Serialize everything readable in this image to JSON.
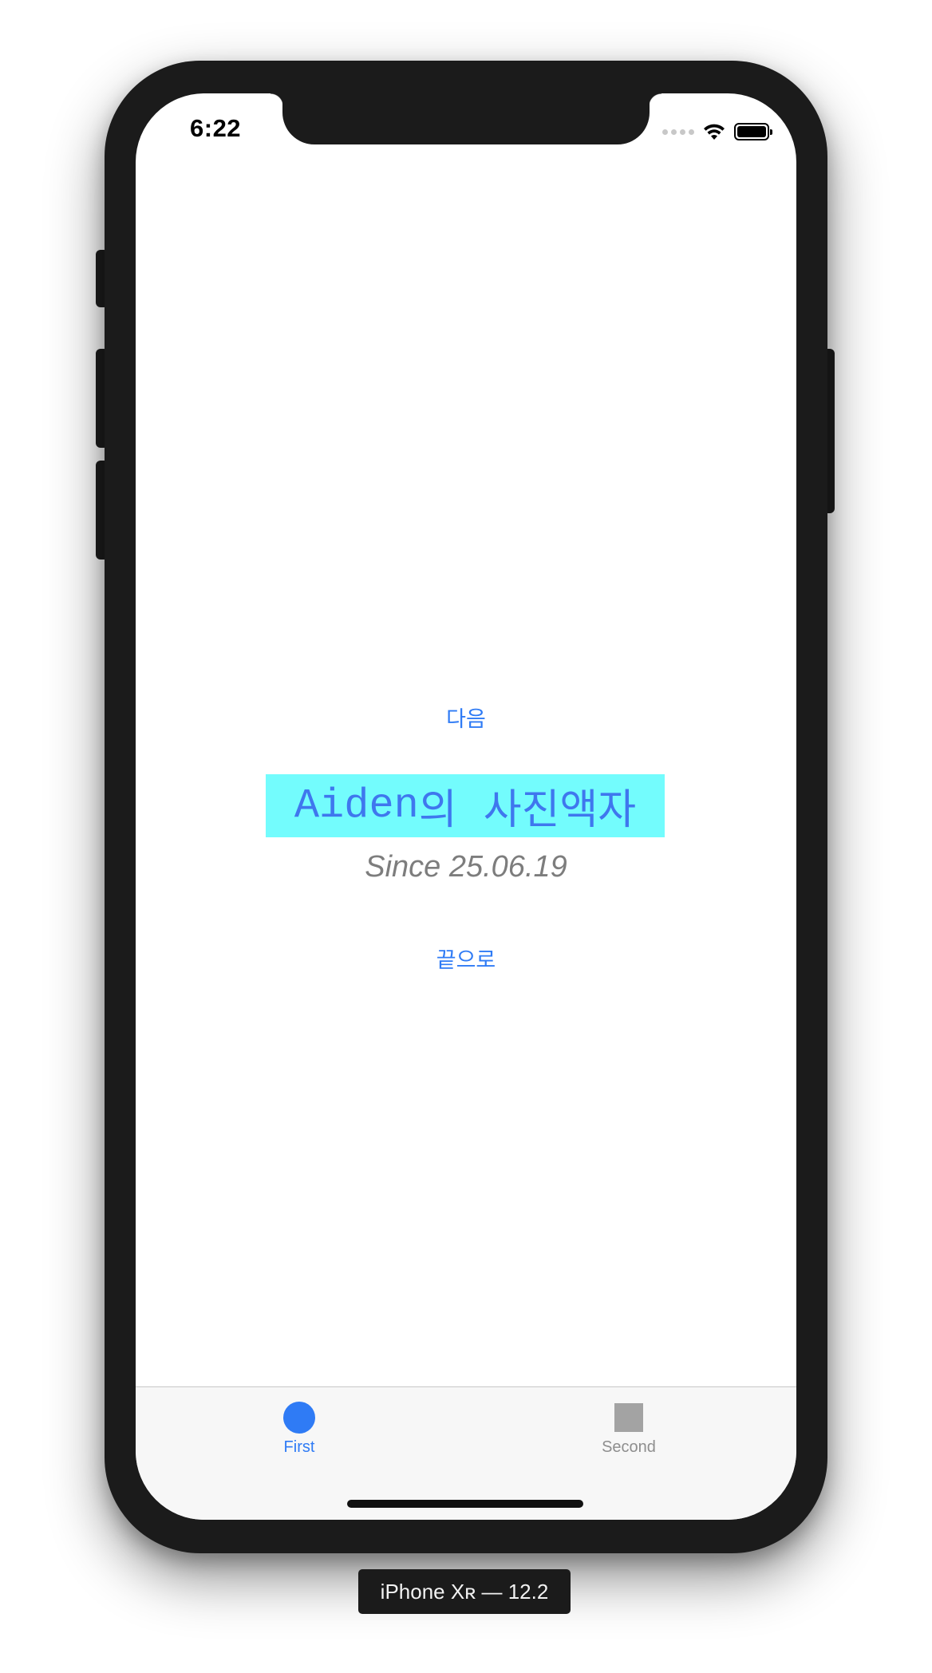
{
  "status_bar": {
    "time": "6:22",
    "icons": [
      "cellular-signal-icon",
      "wifi-icon",
      "battery-icon"
    ]
  },
  "main": {
    "next_label": "다음",
    "title_latin": "Aiden",
    "title_korean": "의  사진액자",
    "since_label": "Since 25.06.19",
    "end_label": "끝으로"
  },
  "tab_bar": {
    "tabs": [
      {
        "label": "First",
        "icon": "circle-icon",
        "selected": true
      },
      {
        "label": "Second",
        "icon": "square-icon",
        "selected": false
      }
    ]
  },
  "simulator": {
    "device_label": "iPhone Xʀ — 12.2"
  },
  "colors": {
    "accent": "#2f7bf5",
    "title_background": "#73fcfd",
    "inactive_tab": "#8e8e8e"
  }
}
